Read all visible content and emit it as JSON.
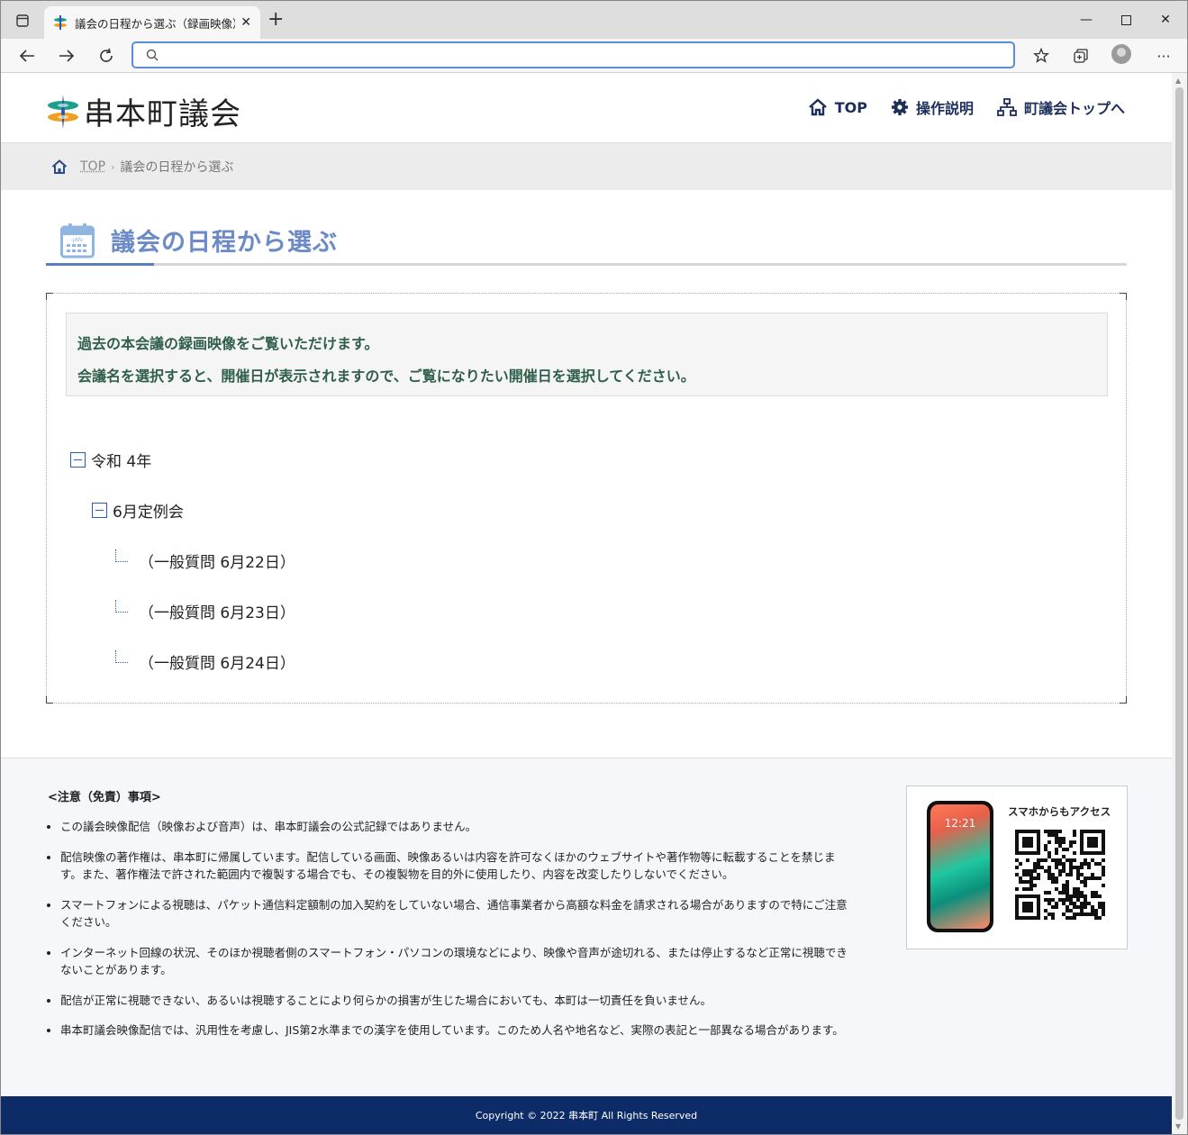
{
  "browser": {
    "tab_title": "議会の日程から選ぶ（録画映像）",
    "address_value": "",
    "address_placeholder": ""
  },
  "site": {
    "name": "串本町議会",
    "nav": [
      {
        "label": "TOP",
        "icon": "home-icon"
      },
      {
        "label": "操作説明",
        "icon": "gear-icon"
      },
      {
        "label": "町議会トップへ",
        "icon": "sitemap-icon"
      }
    ]
  },
  "breadcrumb": {
    "home_icon": "home-icon",
    "top": "TOP",
    "current": "議会の日程から選ぶ"
  },
  "page": {
    "title": "議会の日程から選ぶ",
    "title_icon": "calendar-icon",
    "calendar_icon_text": "-JAN-",
    "notice_line1": "過去の本会議の録画映像をご覧いただけます。",
    "notice_line2": "会議名を選択すると、開催日が表示されますので、ご覧になりたい開催日を選択してください。"
  },
  "tree": {
    "year": "令和 4年",
    "session": "6月定例会",
    "days": [
      "（一般質問 6月22日）",
      "（一般質問 6月23日）",
      "（一般質問 6月24日）"
    ]
  },
  "notes": {
    "heading": "<注意（免責）事項>",
    "items": [
      "この議会映像配信（映像および音声）は、串本町議会の公式記録ではありません。",
      "配信映像の著作権は、串本町に帰属しています。配信している画面、映像あるいは内容を許可なくほかのウェブサイトや著作物等に転載することを禁じます。また、著作権法で許された範囲内で複製する場合でも、その複製物を目的外に使用したり、内容を改変したりしないでください。",
      "スマートフォンによる視聴は、パケット通信料定額制の加入契約をしていない場合、通信事業者から高額な料金を請求される場合がありますので特にご注意ください。",
      "インターネット回線の状況、そのほか視聴者側のスマートフォン・パソコンの環境などにより、映像や音声が途切れる、または停止するなど正常に視聴できないことがあります。",
      "配信が正常に視聴できない、あるいは視聴することにより何らかの損害が生じた場合においても、本町は一切責任を負いません。",
      "串本町議会映像配信では、汎用性を考慮し、JIS第2水準までの漢字を使用しています。このため人名や地名など、実際の表記と一部異なる場合があります。"
    ],
    "qr_caption": "スマホからもアクセス",
    "phone_time": "12:21"
  },
  "footer": {
    "copyright": "Copyright © 2022 串本町 All Rights Reserved"
  },
  "colors": {
    "accent": "#6b8ac6",
    "nav_text": "#1c2e5a",
    "notice_text": "#2f5f4a",
    "footer_bg": "#0d2b66"
  }
}
